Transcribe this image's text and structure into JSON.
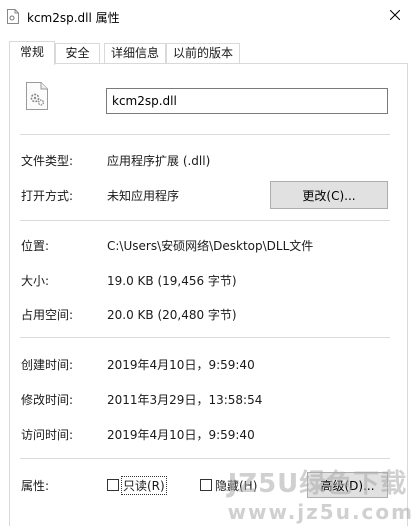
{
  "window": {
    "title": "kcm2sp.dll 属性",
    "icons": {
      "title": "dll-file-icon",
      "close": "close-icon"
    }
  },
  "tabs": [
    {
      "label": "常规",
      "active": true
    },
    {
      "label": "安全",
      "active": false
    },
    {
      "label": "详细信息",
      "active": false
    },
    {
      "label": "以前的版本",
      "active": false
    }
  ],
  "general": {
    "file_icon": "dll-gear-file-icon",
    "file_name": "kcm2sp.dll",
    "file_type": {
      "label": "文件类型:",
      "value": "应用程序扩展 (.dll)"
    },
    "open_with": {
      "label": "打开方式:",
      "value": "未知应用程序",
      "button": "更改(C)..."
    },
    "location": {
      "label": "位置:",
      "value": "C:\\Users\\安硕网络\\Desktop\\DLL文件"
    },
    "size": {
      "label": "大小:",
      "value": "19.0 KB (19,456 字节)"
    },
    "size_on_disk": {
      "label": "占用空间:",
      "value": "20.0 KB (20,480 字节)"
    },
    "created": {
      "label": "创建时间:",
      "value": "2019年4月10日，9:59:40"
    },
    "modified": {
      "label": "修改时间:",
      "value": "2011年3月29日，13:58:54"
    },
    "accessed": {
      "label": "访问时间:",
      "value": "2019年4月10日，9:59:40"
    },
    "attributes": {
      "label": "属性:",
      "readonly": "只读(R)",
      "readonly_checked": false,
      "hidden": "隐藏(H)",
      "hidden_checked": false,
      "advanced": "高级(D)..."
    }
  },
  "watermark": {
    "line1": "JZ5U绿色下载",
    "line2": "www.jz5u.com"
  }
}
